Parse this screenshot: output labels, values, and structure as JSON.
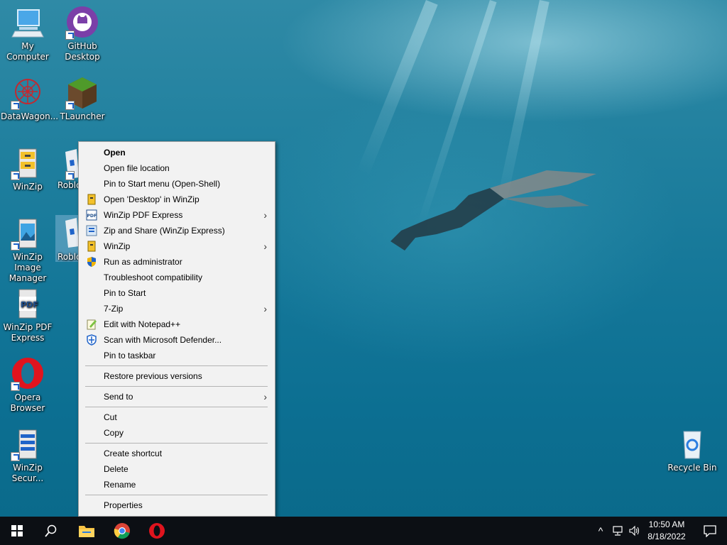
{
  "desktop": {
    "icons": [
      {
        "label": "My Computer"
      },
      {
        "label": "GitHub\nDesktop"
      },
      {
        "label": "DataWagon..."
      },
      {
        "label": "TLauncher"
      },
      {
        "label": "WinZip"
      },
      {
        "label": "Roblo"
      },
      {
        "label": "WinZip Image\nManager"
      },
      {
        "label": "Roblo"
      },
      {
        "label": "WinZip PDF\nExpress"
      },
      {
        "label": "Opera\nBrowser"
      },
      {
        "label": "WinZip\nSecur..."
      },
      {
        "label": "Recycle Bin"
      }
    ]
  },
  "context_menu": {
    "items": [
      {
        "label": "Open",
        "bold": true
      },
      {
        "label": "Open file location"
      },
      {
        "label": "Pin to Start menu (Open-Shell)"
      },
      {
        "label": "Open 'Desktop' in WinZip",
        "icon": "winzip-icon"
      },
      {
        "label": "WinZip PDF Express",
        "icon": "pdf-icon",
        "submenu": true
      },
      {
        "label": "Zip and Share (WinZip Express)",
        "icon": "zip-share-icon"
      },
      {
        "label": "WinZip",
        "icon": "winzip-icon",
        "submenu": true
      },
      {
        "label": "Run as administrator",
        "icon": "shield-icon"
      },
      {
        "label": "Troubleshoot compatibility"
      },
      {
        "label": "Pin to Start"
      },
      {
        "label": "7-Zip",
        "submenu": true
      },
      {
        "label": "Edit with Notepad++",
        "icon": "notepad-icon"
      },
      {
        "label": "Scan with Microsoft Defender...",
        "icon": "defender-icon"
      },
      {
        "label": "Pin to taskbar"
      },
      {
        "label": "Restore previous versions"
      },
      {
        "label": "Send to",
        "submenu": true
      },
      {
        "label": "Cut"
      },
      {
        "label": "Copy"
      },
      {
        "label": "Create shortcut"
      },
      {
        "label": "Delete"
      },
      {
        "label": "Rename"
      },
      {
        "label": "Properties"
      }
    ],
    "submenu_arrow": "›"
  },
  "taskbar": {
    "time": "10:50 AM",
    "date": "8/18/2022",
    "tray_chevron": "^"
  },
  "colors": {
    "menu_bg": "#f2f2f2",
    "taskbar_bg": "#0c0f14",
    "opera_red": "#e0141e"
  }
}
